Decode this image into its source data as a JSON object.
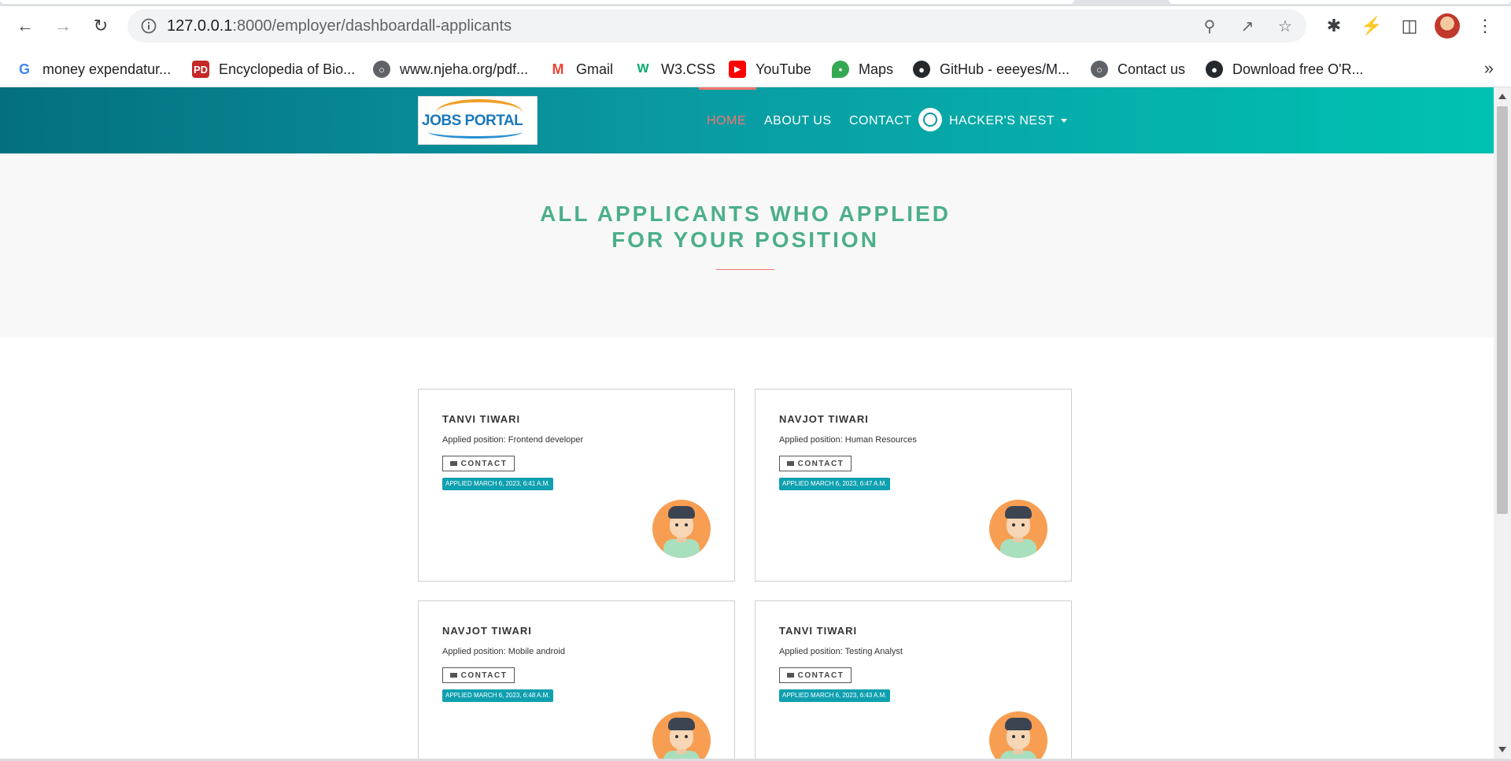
{
  "browser": {
    "url_host": "127.0.0.1",
    "url_rest": ":8000/employer/dashboardall-applicants",
    "bookmarks": [
      {
        "label": "money expendatur...",
        "icon": "google-icon",
        "color": "#4285f4"
      },
      {
        "label": "Encyclopedia of Bio...",
        "icon": "pd-icon",
        "color": "#c62828"
      },
      {
        "label": "www.njeha.org/pdf...",
        "icon": "globe-icon",
        "color": "#5f6368"
      },
      {
        "label": "Gmail",
        "icon": "gmail-icon",
        "color": "#ea4335"
      },
      {
        "label": "W3.CSS",
        "icon": "w3-icon",
        "color": "#04aa6d"
      },
      {
        "label": "YouTube",
        "icon": "youtube-icon",
        "color": "#ff0000"
      },
      {
        "label": "Maps",
        "icon": "maps-icon",
        "color": "#34a853"
      },
      {
        "label": "GitHub - eeeyes/M...",
        "icon": "github-icon",
        "color": "#24292e"
      },
      {
        "label": "Contact us",
        "icon": "globe-icon",
        "color": "#5f6368"
      },
      {
        "label": "Download free O'R...",
        "icon": "github-icon",
        "color": "#24292e"
      }
    ]
  },
  "site": {
    "logo_text": "JOBS PORTAL",
    "nav": {
      "home": "HOME",
      "about": "ABOUT US",
      "contact": "CONTACT",
      "user": "HACKER'S NEST"
    },
    "accent": "#f4756d",
    "heading_color": "#4caf8a"
  },
  "hero": {
    "title_line1": "ALL APPLICANTS WHO APPLIED",
    "title_line2": "FOR YOUR POSITION"
  },
  "applicants": [
    {
      "name": "TANVI TIWARI",
      "position": "Applied position: Frontend developer",
      "contact": "CONTACT",
      "applied": "APPLIED MARCH 6, 2023, 6:41 A.M."
    },
    {
      "name": "NAVJOT TIWARI",
      "position": "Applied position: Human Resources",
      "contact": "CONTACT",
      "applied": "APPLIED MARCH 6, 2023, 6:47 A.M."
    },
    {
      "name": "NAVJOT TIWARI",
      "position": "Applied position: Mobile android",
      "contact": "CONTACT",
      "applied": "APPLIED MARCH 6, 2023, 6:48 A.M."
    },
    {
      "name": "TANVI TIWARI",
      "position": "Applied position: Testing Analyst",
      "contact": "CONTACT",
      "applied": "APPLIED MARCH 6, 2023, 6:43 A.M."
    }
  ]
}
